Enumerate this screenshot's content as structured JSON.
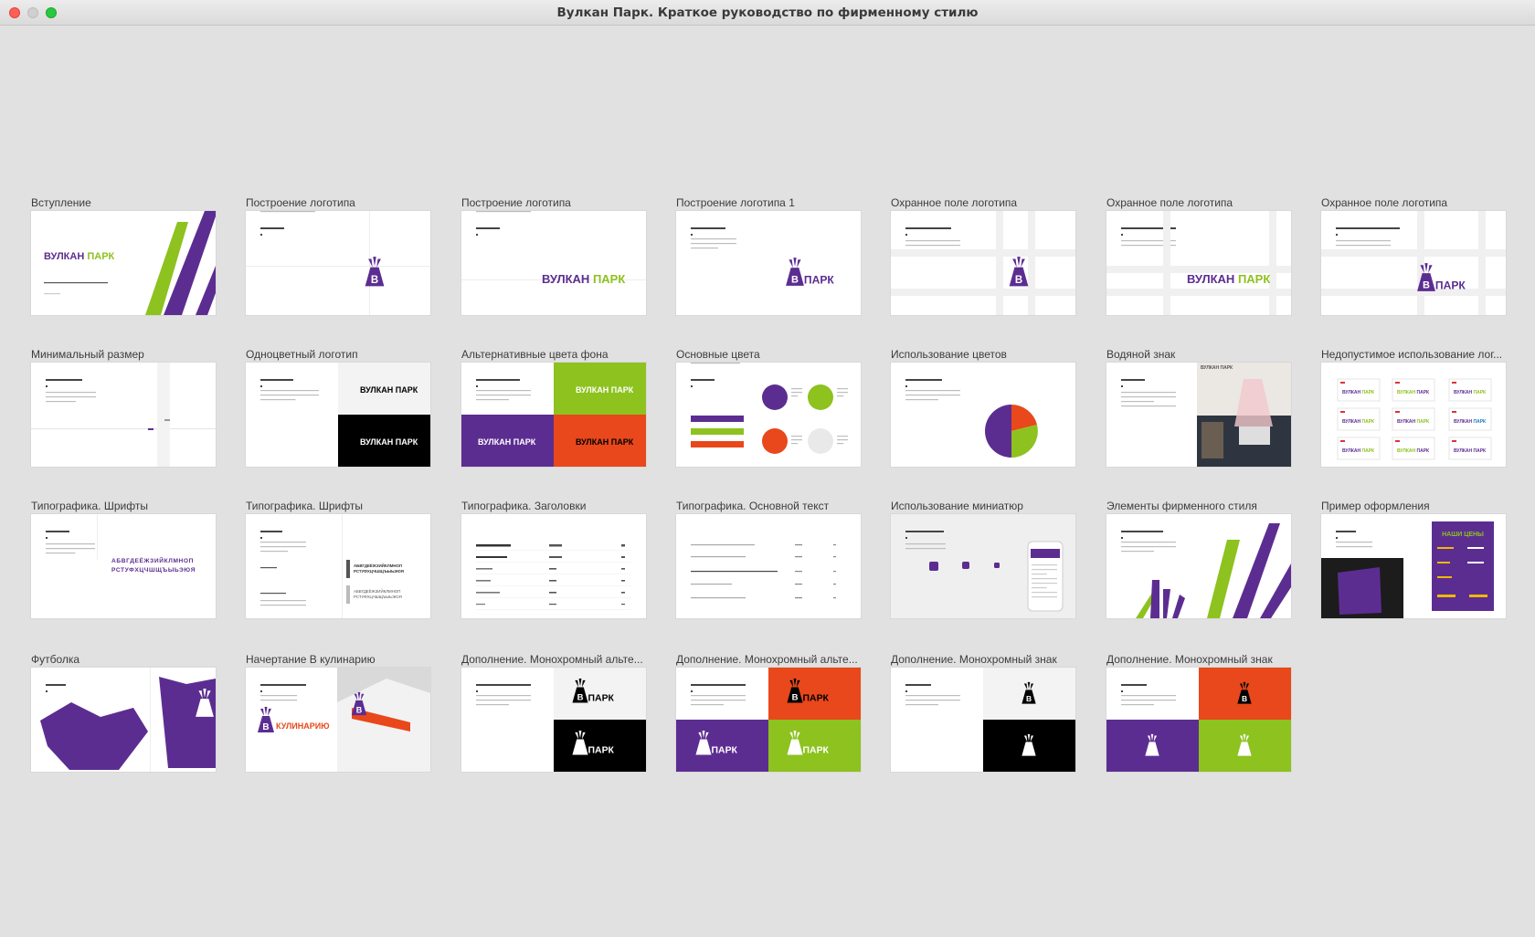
{
  "window": {
    "title": "Вулкан Парк. Краткое руководство по фирменному стилю"
  },
  "colors": {
    "purple": "#5c2d91",
    "green": "#8dc21f",
    "orange": "#e8481b",
    "black": "#000000",
    "gray_bg": "#e1e1e1"
  },
  "slides": [
    {
      "label": "Вступление",
      "kind": "intro"
    },
    {
      "label": "Построение логотипа",
      "kind": "logo-sign"
    },
    {
      "label": "Построение логотипа",
      "kind": "logo-word"
    },
    {
      "label": "Построение логотипа 1",
      "kind": "logo-alt"
    },
    {
      "label": "Охранное поле логотипа",
      "kind": "guard-sign"
    },
    {
      "label": "Охранное поле логотипа",
      "kind": "guard-word"
    },
    {
      "label": "Охранное поле логотипа",
      "kind": "guard-alt"
    },
    {
      "label": "Минимальный размер",
      "kind": "min-size"
    },
    {
      "label": "Одноцветный логотип",
      "kind": "mono-logo"
    },
    {
      "label": "Альтернативные цвета фона",
      "kind": "alt-bg"
    },
    {
      "label": "Основные цвета",
      "kind": "main-colors"
    },
    {
      "label": "Использование цветов",
      "kind": "color-use"
    },
    {
      "label": "Водяной знак",
      "kind": "watermark"
    },
    {
      "label": "Недопустимое использование лог...",
      "kind": "misuse"
    },
    {
      "label": "Типографика. Шрифты",
      "kind": "fonts1"
    },
    {
      "label": "Типографика. Шрифты",
      "kind": "fonts2"
    },
    {
      "label": "Типографика. Заголовки",
      "kind": "headings"
    },
    {
      "label": "Типографика. Основной текст",
      "kind": "bodytext"
    },
    {
      "label": "Использование миниатюр",
      "kind": "mini"
    },
    {
      "label": "Элементы фирменного стиля",
      "kind": "elements"
    },
    {
      "label": "Пример оформления",
      "kind": "example"
    },
    {
      "label": "Футболка",
      "kind": "tshirt"
    },
    {
      "label": "Начертание В кулинарию",
      "kind": "kulinar"
    },
    {
      "label": "Дополнение. Монохромный альте...",
      "kind": "mono-alt-1"
    },
    {
      "label": "Дополнение. Монохромный альте...",
      "kind": "mono-alt-2"
    },
    {
      "label": "Дополнение. Монохромный знак",
      "kind": "mono-sign-1"
    },
    {
      "label": "Дополнение. Монохромный знак",
      "kind": "mono-sign-2"
    }
  ],
  "brand": {
    "word1": "ВУЛКАН",
    "word2": "ПАРК",
    "alphabet1": "АБВГДЕЁЖЗИЙКЛМНОП",
    "alphabet2": "РСТУФХЦЧШЩЪЫЬЭЮЯ",
    "kulinar": "КУЛИНАРИЮ",
    "poster_title": "НАШИ ЦЕНЫ"
  }
}
